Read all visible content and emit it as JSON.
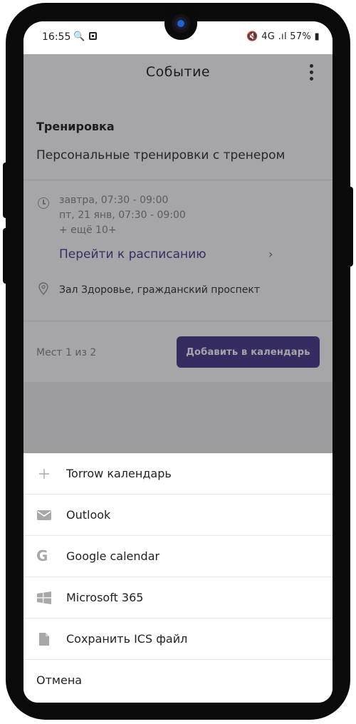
{
  "status_bar": {
    "time": "16:55",
    "right": "4G .ıl 57%"
  },
  "app_bar": {
    "title": "Событие"
  },
  "event": {
    "title": "Тренировка",
    "subtitle": "Персональные тренировки с тренером",
    "times": [
      "завтра, 07:30 - 09:00",
      "пт, 21 янв, 07:30 - 09:00",
      "+ ещё 10+"
    ],
    "schedule_link": "Перейти к расписанию",
    "location": "Зал Здоровье, гражданский проспект",
    "seats": "Мест 1 из 2",
    "add_button": "Добавить в календарь"
  },
  "sheet": {
    "items": [
      {
        "label": "Torrow календарь",
        "icon": "plus-icon"
      },
      {
        "label": "Outlook",
        "icon": "mail-icon"
      },
      {
        "label": "Google calendar",
        "icon": "google-icon"
      },
      {
        "label": "Microsoft 365",
        "icon": "windows-icon"
      },
      {
        "label": "Сохранить ICS файл",
        "icon": "file-icon"
      }
    ],
    "cancel": "Отмена"
  },
  "colors": {
    "accent": "#4c3a8c",
    "link": "#4a3d8f"
  }
}
